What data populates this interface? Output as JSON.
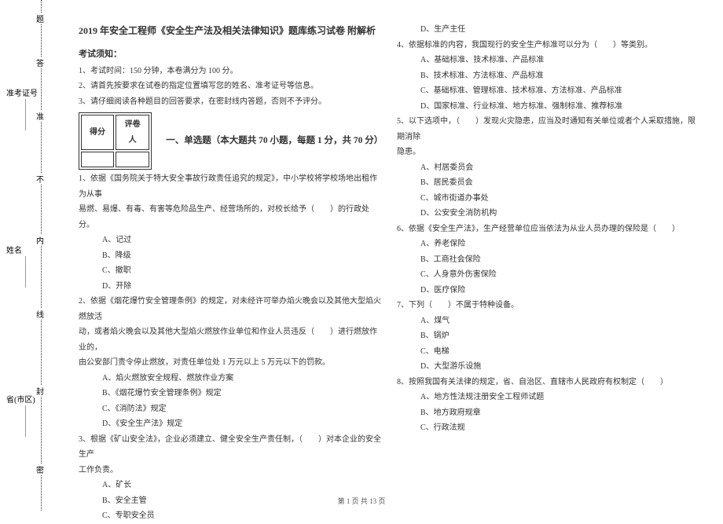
{
  "binding": {
    "province_label": "省(市区)",
    "name_label": "姓名",
    "ticket_label": "准考证号",
    "seal_mi": "密",
    "seal_feng": "封",
    "seal_xian": "线",
    "seal_nei": "内",
    "seal_bu": "不",
    "seal_zhun": "准",
    "seal_da": "答",
    "seal_ti": "题"
  },
  "header": {
    "title": "2019 年安全工程师《安全生产法及相关法律知识》题库练习试卷 附解析",
    "notice_head": "考试须知：",
    "notice1": "1、考试时间：150 分钟，本卷满分为 100 分。",
    "notice2": "2、请首先按要求在试卷的指定位置填写您的姓名、准考证号等信息。",
    "notice3": "3、请仔细阅读各种题目的回答要求，在密封线内答题，否则不予评分。"
  },
  "scorebox": {
    "c1": "得分",
    "c2": "评卷人"
  },
  "section1_title": "一、单选题（本大题共 70 小题，每题 1 分，共 70 分）",
  "q1": {
    "stem1": "1、依据《国务院关于特大安全事故行政责任追究的规定》，中小学校将学校场地出租作为从事",
    "stem2": "易燃、易爆、有毒、有害等危险品生产、经营场所的，对校长给予（　　）的行政处分。",
    "a": "A、记过",
    "b": "B、降级",
    "c": "C、撤职",
    "d": "D、开除"
  },
  "q2": {
    "stem1": "2、依据《烟花爆竹安全管理条例》的规定，对未经许可举办焰火晚会以及其他大型焰火燃放活",
    "stem2": "动，或者焰火晚会以及其他大型焰火燃放作业单位和作业人员违反（　　）进行燃放作业的，",
    "stem3": "由公安部门责令停止燃放，对责任单位处 1 万元以上 5 万元以下的罚款。",
    "a": "A、焰火燃放安全规程、燃放作业方案",
    "b": "B、《烟花爆竹安全管理条例》规定",
    "c": "C、《消防法》规定",
    "d": "D、《安全生产法》规定"
  },
  "q3": {
    "stem1": "3、根据《矿山安全法》，企业必须建立、健全安全生产责任制，（　　）对本企业的安全生产",
    "stem2": "工作负责。",
    "a": "A、矿长",
    "b": "B、安全主管",
    "c": "C、专职安全员",
    "d": "D、生产主任"
  },
  "q4": {
    "stem": "4、依据标准的内容，我国现行的安全生产标准可以分为（　　）等类别。",
    "a": "A、基础标准、技术标准、产品标准",
    "b": "B、技术标准、方法标准、产品标准",
    "c": "C、基础标准、管理标准、技术标准、方法标准、产品标准",
    "d": "D、国家标准、行业标准、地方标准、强制标准、推荐标准"
  },
  "q5": {
    "stem1": "5、以下选项中，（　　）发现火灾隐患，应当及时通知有关单位或者个人采取措施，限期消除",
    "stem2": "隐患。",
    "a": "A、村居委员会",
    "b": "B、居民委员会",
    "c": "C、城市街道办事处",
    "d": "D、公安安全消防机构"
  },
  "q6": {
    "stem": "6、依据《安全生产法》，生产经营单位应当依法为从业人员办理的保险是（　　）",
    "a": "A、养老保险",
    "b": "B、工商社会保险",
    "c": "C、人身意外伤害保险",
    "d": "D、医疗保险"
  },
  "q7": {
    "stem": "7、下列（　　）不属于特种设备。",
    "a": "A、煤气",
    "b": "B、锅炉",
    "c": "C、电梯",
    "d": "D、大型游乐设施"
  },
  "q8": {
    "stem": "8、按照我国有关法律的规定，省、自治区、直辖市人民政府有权制定（　　）",
    "a": "A、地方性法规注册安全工程师试题",
    "b": "B、地方政府规章",
    "c": "C、行政法规"
  },
  "footer": "第 1 页 共 13 页"
}
